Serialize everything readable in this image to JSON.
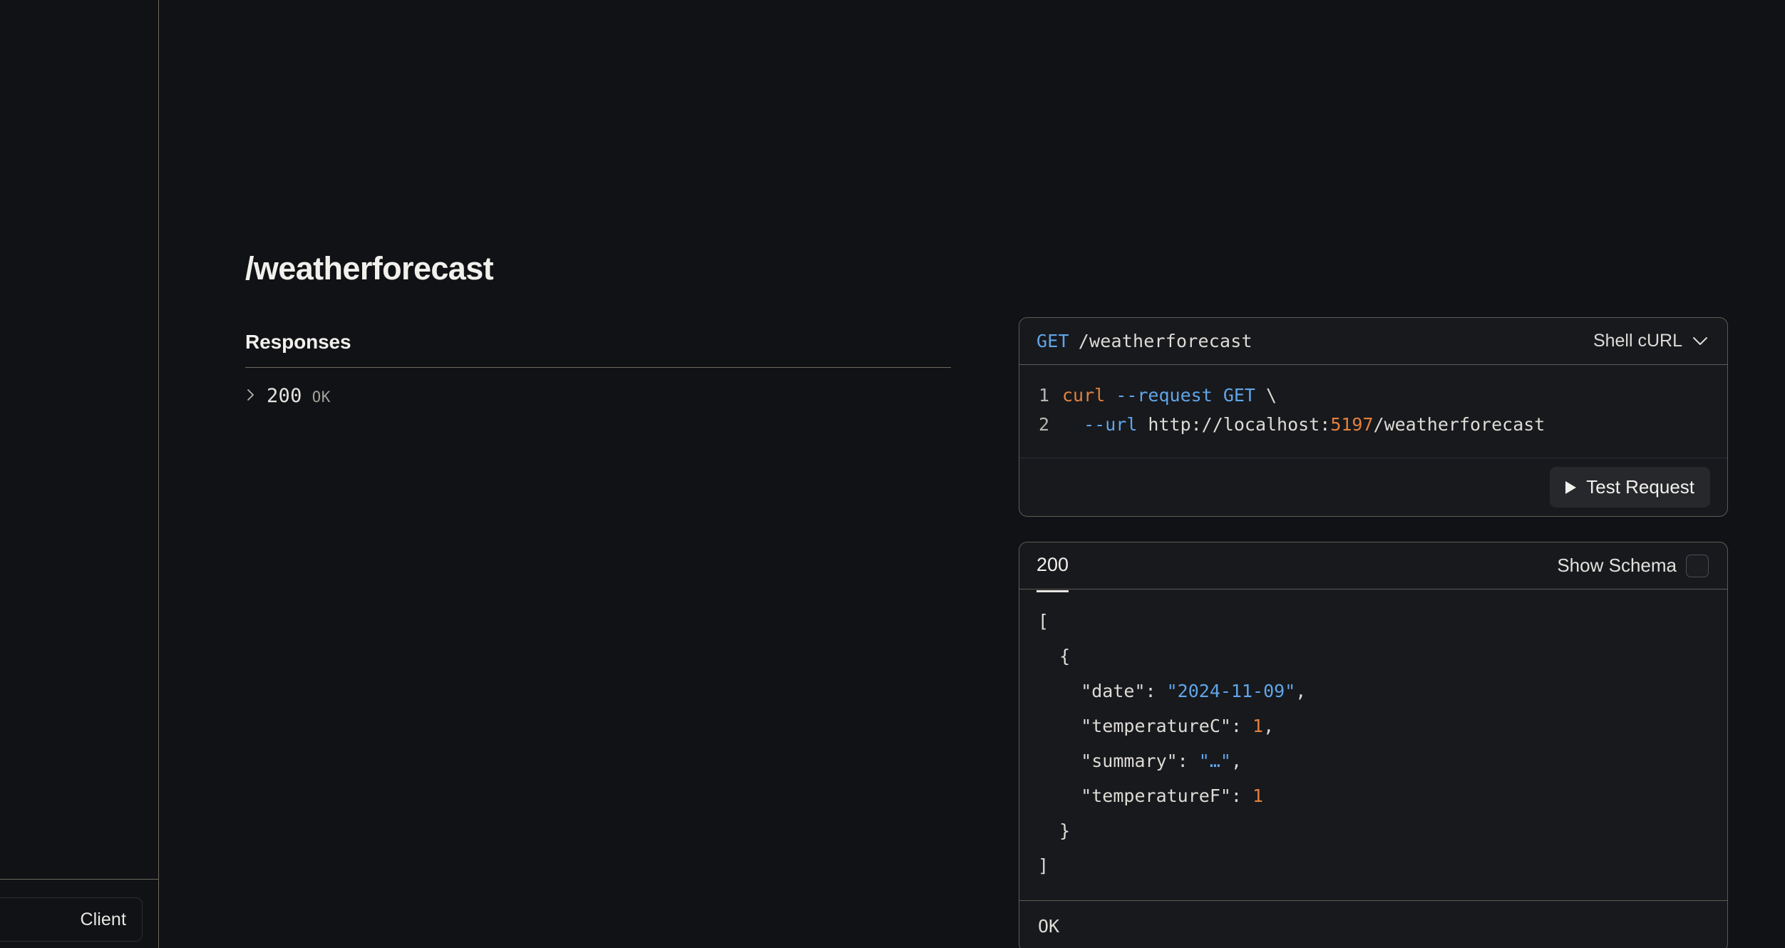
{
  "sidebar": {
    "footer_button_label": "Client"
  },
  "doc": {
    "title": "/weatherforecast",
    "responses_heading": "Responses",
    "response_items": [
      {
        "code": "200",
        "text": "OK"
      }
    ]
  },
  "request_panel": {
    "method": "GET",
    "path": "/weatherforecast",
    "language_label": "Shell cURL",
    "chevron_icon": "chevron-down-icon",
    "code_lines": [
      {
        "number": "1",
        "tokens": [
          {
            "text": "curl",
            "type": "cmd"
          },
          {
            "text": " ",
            "type": "plain"
          },
          {
            "text": "--request",
            "type": "flag"
          },
          {
            "text": " ",
            "type": "plain"
          },
          {
            "text": "GET",
            "type": "flag"
          },
          {
            "text": " \\",
            "type": "plain"
          }
        ]
      },
      {
        "number": "2",
        "tokens": [
          {
            "text": "  ",
            "type": "plain"
          },
          {
            "text": "--url",
            "type": "flag"
          },
          {
            "text": " http://localhost:",
            "type": "plain"
          },
          {
            "text": "5197",
            "type": "num"
          },
          {
            "text": "/weatherforecast",
            "type": "plain"
          }
        ]
      }
    ],
    "test_button_label": "Test Request",
    "play_icon": "play-icon"
  },
  "response_panel": {
    "tab_label": "200",
    "show_schema_label": "Show Schema",
    "show_schema_checked": false,
    "json_lines": [
      [
        {
          "text": "[",
          "type": "plain"
        }
      ],
      [
        {
          "text": "  {",
          "type": "plain"
        }
      ],
      [
        {
          "text": "    \"date\": ",
          "type": "plain"
        },
        {
          "text": "\"2024-11-09\"",
          "type": "str"
        },
        {
          "text": ",",
          "type": "plain"
        }
      ],
      [
        {
          "text": "    \"temperatureC\": ",
          "type": "plain"
        },
        {
          "text": "1",
          "type": "num"
        },
        {
          "text": ",",
          "type": "plain"
        }
      ],
      [
        {
          "text": "    \"summary\": ",
          "type": "plain"
        },
        {
          "text": "\"…\"",
          "type": "str"
        },
        {
          "text": ",",
          "type": "plain"
        }
      ],
      [
        {
          "text": "    \"temperatureF\": ",
          "type": "plain"
        },
        {
          "text": "1",
          "type": "num"
        }
      ],
      [
        {
          "text": "  }",
          "type": "plain"
        }
      ],
      [
        {
          "text": "]",
          "type": "plain"
        }
      ]
    ],
    "status_text": "OK"
  },
  "colors": {
    "page_bg": "#101215",
    "panel_bg": "#17191d",
    "panel_border": "#5f5b52",
    "accent_blue": "#61a5e8",
    "accent_orange": "#e3803d",
    "text_primary": "#f2f0ec",
    "text_muted": "#a3a099"
  }
}
